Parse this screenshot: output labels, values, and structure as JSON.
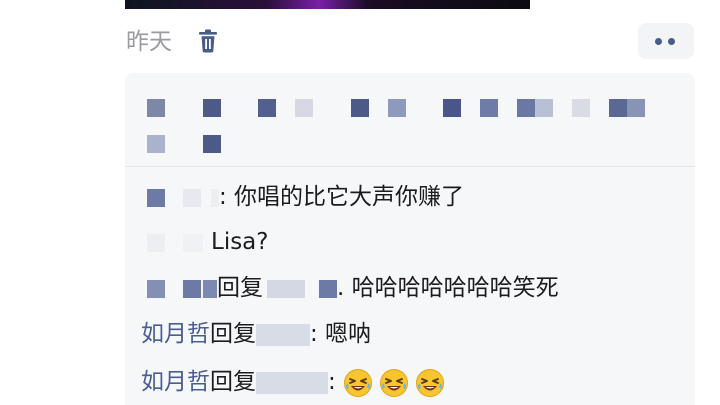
{
  "post": {
    "date_label": "昨天"
  },
  "comments": [
    {
      "text": ": 你唱的比它大声你赚了"
    },
    {
      "text": "Lisa?"
    },
    {
      "reply_word": "回复",
      "text": ". 哈哈哈哈哈哈哈笑死"
    },
    {
      "user": "如月哲",
      "reply_word": "回复",
      "text": ": 嗯呐"
    },
    {
      "user": "如月哲",
      "reply_word": "回复",
      "text": ": ",
      "emojis": [
        "laugh-cry-emoji",
        "laugh-cry-emoji",
        "laugh-cry-emoji"
      ]
    }
  ],
  "icons": {
    "delete": "trash-icon",
    "more": "more-dots-icon"
  },
  "colors": {
    "username": "#4b5d91",
    "secondary_text": "#9a9aa0",
    "panel_bg": "#f6f7f9",
    "icon_accent": "#475c86"
  }
}
